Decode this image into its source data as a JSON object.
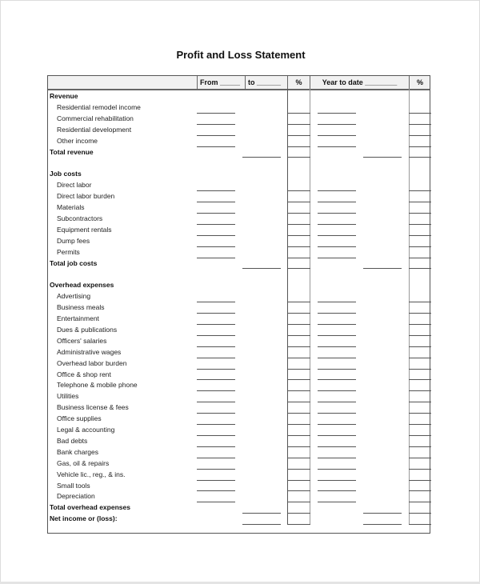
{
  "document": {
    "title": "Profit and Loss Statement"
  },
  "header": {
    "label_col": "",
    "from": "From _____",
    "to": "to ______",
    "pct1": "%",
    "ytd": "Year to date ________",
    "pct2": "%"
  },
  "rows": [
    {
      "label": "Revenue",
      "type": "section"
    },
    {
      "label": "Residential remodel income",
      "type": "item"
    },
    {
      "label": "Commercial rehabilitation",
      "type": "item"
    },
    {
      "label": "Residential development",
      "type": "item"
    },
    {
      "label": "Other income",
      "type": "item"
    },
    {
      "label": "Total revenue",
      "type": "total"
    },
    {
      "label": "",
      "type": "spacer"
    },
    {
      "label": "Job costs",
      "type": "section"
    },
    {
      "label": "Direct labor",
      "type": "item"
    },
    {
      "label": "Direct labor burden",
      "type": "item"
    },
    {
      "label": "Materials",
      "type": "item"
    },
    {
      "label": "Subcontractors",
      "type": "item"
    },
    {
      "label": "Equipment rentals",
      "type": "item"
    },
    {
      "label": "Dump fees",
      "type": "item"
    },
    {
      "label": "Permits",
      "type": "item"
    },
    {
      "label": "Total job costs",
      "type": "total"
    },
    {
      "label": "",
      "type": "spacer"
    },
    {
      "label": "Overhead expenses",
      "type": "section"
    },
    {
      "label": "Advertising",
      "type": "item"
    },
    {
      "label": "Business meals",
      "type": "item"
    },
    {
      "label": "Entertainment",
      "type": "item"
    },
    {
      "label": "Dues & publications",
      "type": "item"
    },
    {
      "label": "Officers' salaries",
      "type": "item"
    },
    {
      "label": "Administrative wages",
      "type": "item"
    },
    {
      "label": "Overhead labor burden",
      "type": "item"
    },
    {
      "label": "Office & shop rent",
      "type": "item"
    },
    {
      "label": "Telephone & mobile phone",
      "type": "item"
    },
    {
      "label": "Utilities",
      "type": "item"
    },
    {
      "label": "Business license & fees",
      "type": "item"
    },
    {
      "label": "Office supplies",
      "type": "item"
    },
    {
      "label": "Legal & accounting",
      "type": "item"
    },
    {
      "label": "Bad debts",
      "type": "item"
    },
    {
      "label": "Bank charges",
      "type": "item"
    },
    {
      "label": "Gas, oil & repairs",
      "type": "item"
    },
    {
      "label": "Vehicle lic., reg., & ins.",
      "type": "item"
    },
    {
      "label": "Small tools",
      "type": "item"
    },
    {
      "label": "Depreciation",
      "type": "item"
    },
    {
      "label": "Total overhead expenses",
      "type": "total"
    },
    {
      "label": "Net income or (loss):",
      "type": "total"
    }
  ]
}
